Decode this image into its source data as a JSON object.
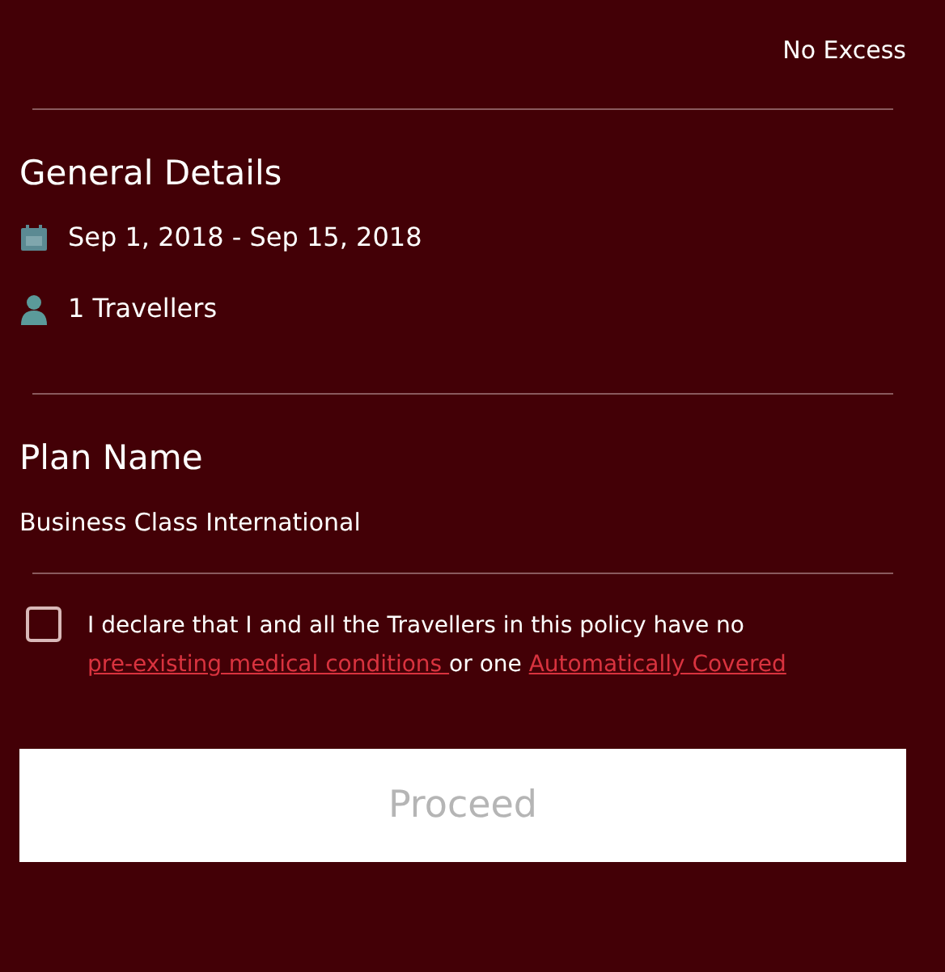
{
  "excess": "No Excess",
  "general_details": {
    "title": "General Details",
    "dates": "Sep 1, 2018 - Sep 15, 2018",
    "travellers": "1 Travellers"
  },
  "plan": {
    "title": "Plan Name",
    "name": "Business Class International"
  },
  "declaration": {
    "checked": false,
    "parts": [
      {
        "kind": "text",
        "text": "I declare that I and all the Travellers in this policy have no "
      },
      {
        "kind": "link",
        "text": "pre-existing medical conditions "
      },
      {
        "kind": "text",
        "text": " or one "
      },
      {
        "kind": "link",
        "text": "Automatically Covered"
      }
    ]
  },
  "proceed_button": {
    "label": "Proceed",
    "disabled": true
  }
}
